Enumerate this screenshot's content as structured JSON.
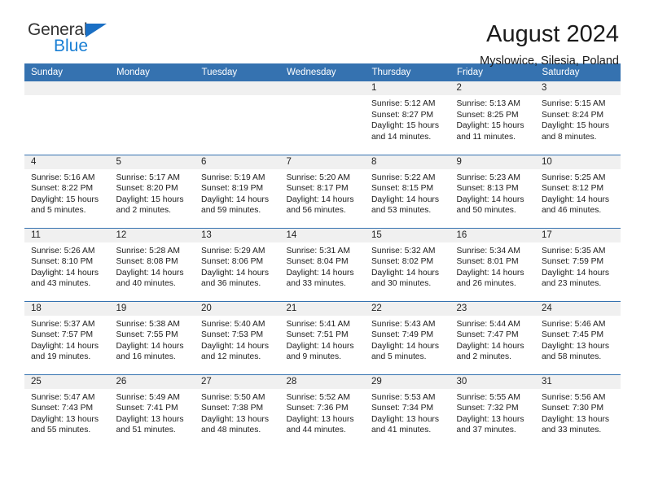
{
  "logo": {
    "word1": "General",
    "word2": "Blue",
    "triangle_color": "#1a6fc4",
    "word2_color": "#1a7fd4"
  },
  "header": {
    "title": "August 2024",
    "subtitle": "Myslowice, Silesia, Poland"
  },
  "theme": {
    "header_bar_color": "#3572b0",
    "daynum_band_color": "#f0f0f0",
    "grid_line_color": "#3572b0",
    "text_color": "#1c1c1c"
  },
  "weekday_headers": [
    "Sunday",
    "Monday",
    "Tuesday",
    "Wednesday",
    "Thursday",
    "Friday",
    "Saturday"
  ],
  "labels": {
    "sunrise_prefix": "Sunrise:",
    "sunset_prefix": "Sunset:",
    "daylight_prefix": "Daylight:"
  },
  "weeks": [
    [
      {
        "day": "",
        "blank": true,
        "sunrise": "",
        "sunset": "",
        "daylight_line1": "",
        "daylight_line2": ""
      },
      {
        "day": "",
        "blank": true,
        "sunrise": "",
        "sunset": "",
        "daylight_line1": "",
        "daylight_line2": ""
      },
      {
        "day": "",
        "blank": true,
        "sunrise": "",
        "sunset": "",
        "daylight_line1": "",
        "daylight_line2": ""
      },
      {
        "day": "",
        "blank": true,
        "sunrise": "",
        "sunset": "",
        "daylight_line1": "",
        "daylight_line2": ""
      },
      {
        "day": "1",
        "blank": false,
        "sunrise": "Sunrise: 5:12 AM",
        "sunset": "Sunset: 8:27 PM",
        "daylight_line1": "Daylight: 15 hours",
        "daylight_line2": "and 14 minutes."
      },
      {
        "day": "2",
        "blank": false,
        "sunrise": "Sunrise: 5:13 AM",
        "sunset": "Sunset: 8:25 PM",
        "daylight_line1": "Daylight: 15 hours",
        "daylight_line2": "and 11 minutes."
      },
      {
        "day": "3",
        "blank": false,
        "sunrise": "Sunrise: 5:15 AM",
        "sunset": "Sunset: 8:24 PM",
        "daylight_line1": "Daylight: 15 hours",
        "daylight_line2": "and 8 minutes."
      }
    ],
    [
      {
        "day": "4",
        "blank": false,
        "sunrise": "Sunrise: 5:16 AM",
        "sunset": "Sunset: 8:22 PM",
        "daylight_line1": "Daylight: 15 hours",
        "daylight_line2": "and 5 minutes."
      },
      {
        "day": "5",
        "blank": false,
        "sunrise": "Sunrise: 5:17 AM",
        "sunset": "Sunset: 8:20 PM",
        "daylight_line1": "Daylight: 15 hours",
        "daylight_line2": "and 2 minutes."
      },
      {
        "day": "6",
        "blank": false,
        "sunrise": "Sunrise: 5:19 AM",
        "sunset": "Sunset: 8:19 PM",
        "daylight_line1": "Daylight: 14 hours",
        "daylight_line2": "and 59 minutes."
      },
      {
        "day": "7",
        "blank": false,
        "sunrise": "Sunrise: 5:20 AM",
        "sunset": "Sunset: 8:17 PM",
        "daylight_line1": "Daylight: 14 hours",
        "daylight_line2": "and 56 minutes."
      },
      {
        "day": "8",
        "blank": false,
        "sunrise": "Sunrise: 5:22 AM",
        "sunset": "Sunset: 8:15 PM",
        "daylight_line1": "Daylight: 14 hours",
        "daylight_line2": "and 53 minutes."
      },
      {
        "day": "9",
        "blank": false,
        "sunrise": "Sunrise: 5:23 AM",
        "sunset": "Sunset: 8:13 PM",
        "daylight_line1": "Daylight: 14 hours",
        "daylight_line2": "and 50 minutes."
      },
      {
        "day": "10",
        "blank": false,
        "sunrise": "Sunrise: 5:25 AM",
        "sunset": "Sunset: 8:12 PM",
        "daylight_line1": "Daylight: 14 hours",
        "daylight_line2": "and 46 minutes."
      }
    ],
    [
      {
        "day": "11",
        "blank": false,
        "sunrise": "Sunrise: 5:26 AM",
        "sunset": "Sunset: 8:10 PM",
        "daylight_line1": "Daylight: 14 hours",
        "daylight_line2": "and 43 minutes."
      },
      {
        "day": "12",
        "blank": false,
        "sunrise": "Sunrise: 5:28 AM",
        "sunset": "Sunset: 8:08 PM",
        "daylight_line1": "Daylight: 14 hours",
        "daylight_line2": "and 40 minutes."
      },
      {
        "day": "13",
        "blank": false,
        "sunrise": "Sunrise: 5:29 AM",
        "sunset": "Sunset: 8:06 PM",
        "daylight_line1": "Daylight: 14 hours",
        "daylight_line2": "and 36 minutes."
      },
      {
        "day": "14",
        "blank": false,
        "sunrise": "Sunrise: 5:31 AM",
        "sunset": "Sunset: 8:04 PM",
        "daylight_line1": "Daylight: 14 hours",
        "daylight_line2": "and 33 minutes."
      },
      {
        "day": "15",
        "blank": false,
        "sunrise": "Sunrise: 5:32 AM",
        "sunset": "Sunset: 8:02 PM",
        "daylight_line1": "Daylight: 14 hours",
        "daylight_line2": "and 30 minutes."
      },
      {
        "day": "16",
        "blank": false,
        "sunrise": "Sunrise: 5:34 AM",
        "sunset": "Sunset: 8:01 PM",
        "daylight_line1": "Daylight: 14 hours",
        "daylight_line2": "and 26 minutes."
      },
      {
        "day": "17",
        "blank": false,
        "sunrise": "Sunrise: 5:35 AM",
        "sunset": "Sunset: 7:59 PM",
        "daylight_line1": "Daylight: 14 hours",
        "daylight_line2": "and 23 minutes."
      }
    ],
    [
      {
        "day": "18",
        "blank": false,
        "sunrise": "Sunrise: 5:37 AM",
        "sunset": "Sunset: 7:57 PM",
        "daylight_line1": "Daylight: 14 hours",
        "daylight_line2": "and 19 minutes."
      },
      {
        "day": "19",
        "blank": false,
        "sunrise": "Sunrise: 5:38 AM",
        "sunset": "Sunset: 7:55 PM",
        "daylight_line1": "Daylight: 14 hours",
        "daylight_line2": "and 16 minutes."
      },
      {
        "day": "20",
        "blank": false,
        "sunrise": "Sunrise: 5:40 AM",
        "sunset": "Sunset: 7:53 PM",
        "daylight_line1": "Daylight: 14 hours",
        "daylight_line2": "and 12 minutes."
      },
      {
        "day": "21",
        "blank": false,
        "sunrise": "Sunrise: 5:41 AM",
        "sunset": "Sunset: 7:51 PM",
        "daylight_line1": "Daylight: 14 hours",
        "daylight_line2": "and 9 minutes."
      },
      {
        "day": "22",
        "blank": false,
        "sunrise": "Sunrise: 5:43 AM",
        "sunset": "Sunset: 7:49 PM",
        "daylight_line1": "Daylight: 14 hours",
        "daylight_line2": "and 5 minutes."
      },
      {
        "day": "23",
        "blank": false,
        "sunrise": "Sunrise: 5:44 AM",
        "sunset": "Sunset: 7:47 PM",
        "daylight_line1": "Daylight: 14 hours",
        "daylight_line2": "and 2 minutes."
      },
      {
        "day": "24",
        "blank": false,
        "sunrise": "Sunrise: 5:46 AM",
        "sunset": "Sunset: 7:45 PM",
        "daylight_line1": "Daylight: 13 hours",
        "daylight_line2": "and 58 minutes."
      }
    ],
    [
      {
        "day": "25",
        "blank": false,
        "sunrise": "Sunrise: 5:47 AM",
        "sunset": "Sunset: 7:43 PM",
        "daylight_line1": "Daylight: 13 hours",
        "daylight_line2": "and 55 minutes."
      },
      {
        "day": "26",
        "blank": false,
        "sunrise": "Sunrise: 5:49 AM",
        "sunset": "Sunset: 7:41 PM",
        "daylight_line1": "Daylight: 13 hours",
        "daylight_line2": "and 51 minutes."
      },
      {
        "day": "27",
        "blank": false,
        "sunrise": "Sunrise: 5:50 AM",
        "sunset": "Sunset: 7:38 PM",
        "daylight_line1": "Daylight: 13 hours",
        "daylight_line2": "and 48 minutes."
      },
      {
        "day": "28",
        "blank": false,
        "sunrise": "Sunrise: 5:52 AM",
        "sunset": "Sunset: 7:36 PM",
        "daylight_line1": "Daylight: 13 hours",
        "daylight_line2": "and 44 minutes."
      },
      {
        "day": "29",
        "blank": false,
        "sunrise": "Sunrise: 5:53 AM",
        "sunset": "Sunset: 7:34 PM",
        "daylight_line1": "Daylight: 13 hours",
        "daylight_line2": "and 41 minutes."
      },
      {
        "day": "30",
        "blank": false,
        "sunrise": "Sunrise: 5:55 AM",
        "sunset": "Sunset: 7:32 PM",
        "daylight_line1": "Daylight: 13 hours",
        "daylight_line2": "and 37 minutes."
      },
      {
        "day": "31",
        "blank": false,
        "sunrise": "Sunrise: 5:56 AM",
        "sunset": "Sunset: 7:30 PM",
        "daylight_line1": "Daylight: 13 hours",
        "daylight_line2": "and 33 minutes."
      }
    ]
  ]
}
